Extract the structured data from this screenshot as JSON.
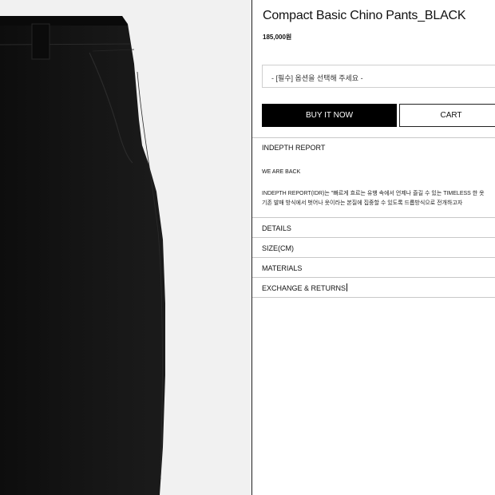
{
  "product": {
    "title": "Compact Basic Chino Pants_BLACK",
    "price": "185,000원",
    "image_desc_icon": "pants-photo"
  },
  "option": {
    "placeholder": "- [필수] 옵션을 선택해 주세요 -"
  },
  "actions": {
    "buy_label": "BUY IT NOW",
    "cart_label": "CART"
  },
  "report": {
    "heading": "INDEPTH REPORT",
    "subheading": "WE ARE BACK",
    "line1": "INDEPTH REPORT(IDR)는 \"빠르게 흐르는 유행 속에서 언제나 즐길 수 있는 TIMELESS 한 옷",
    "line2": "기존 발매 방식에서 벗어나 옷이라는 본질에 집중할 수 있도록 드롭방식으로 전개하고자"
  },
  "sections": [
    {
      "label": "DETAILS"
    },
    {
      "label": "SIZE(CM)"
    },
    {
      "label": "MATERIALS"
    },
    {
      "label": "EXCHANGE & RETURNS"
    }
  ],
  "colors": {
    "buy_bg": "#000000",
    "buy_fg": "#ffffff",
    "image_bg": "#f1f1f1",
    "garment": "#121212"
  }
}
